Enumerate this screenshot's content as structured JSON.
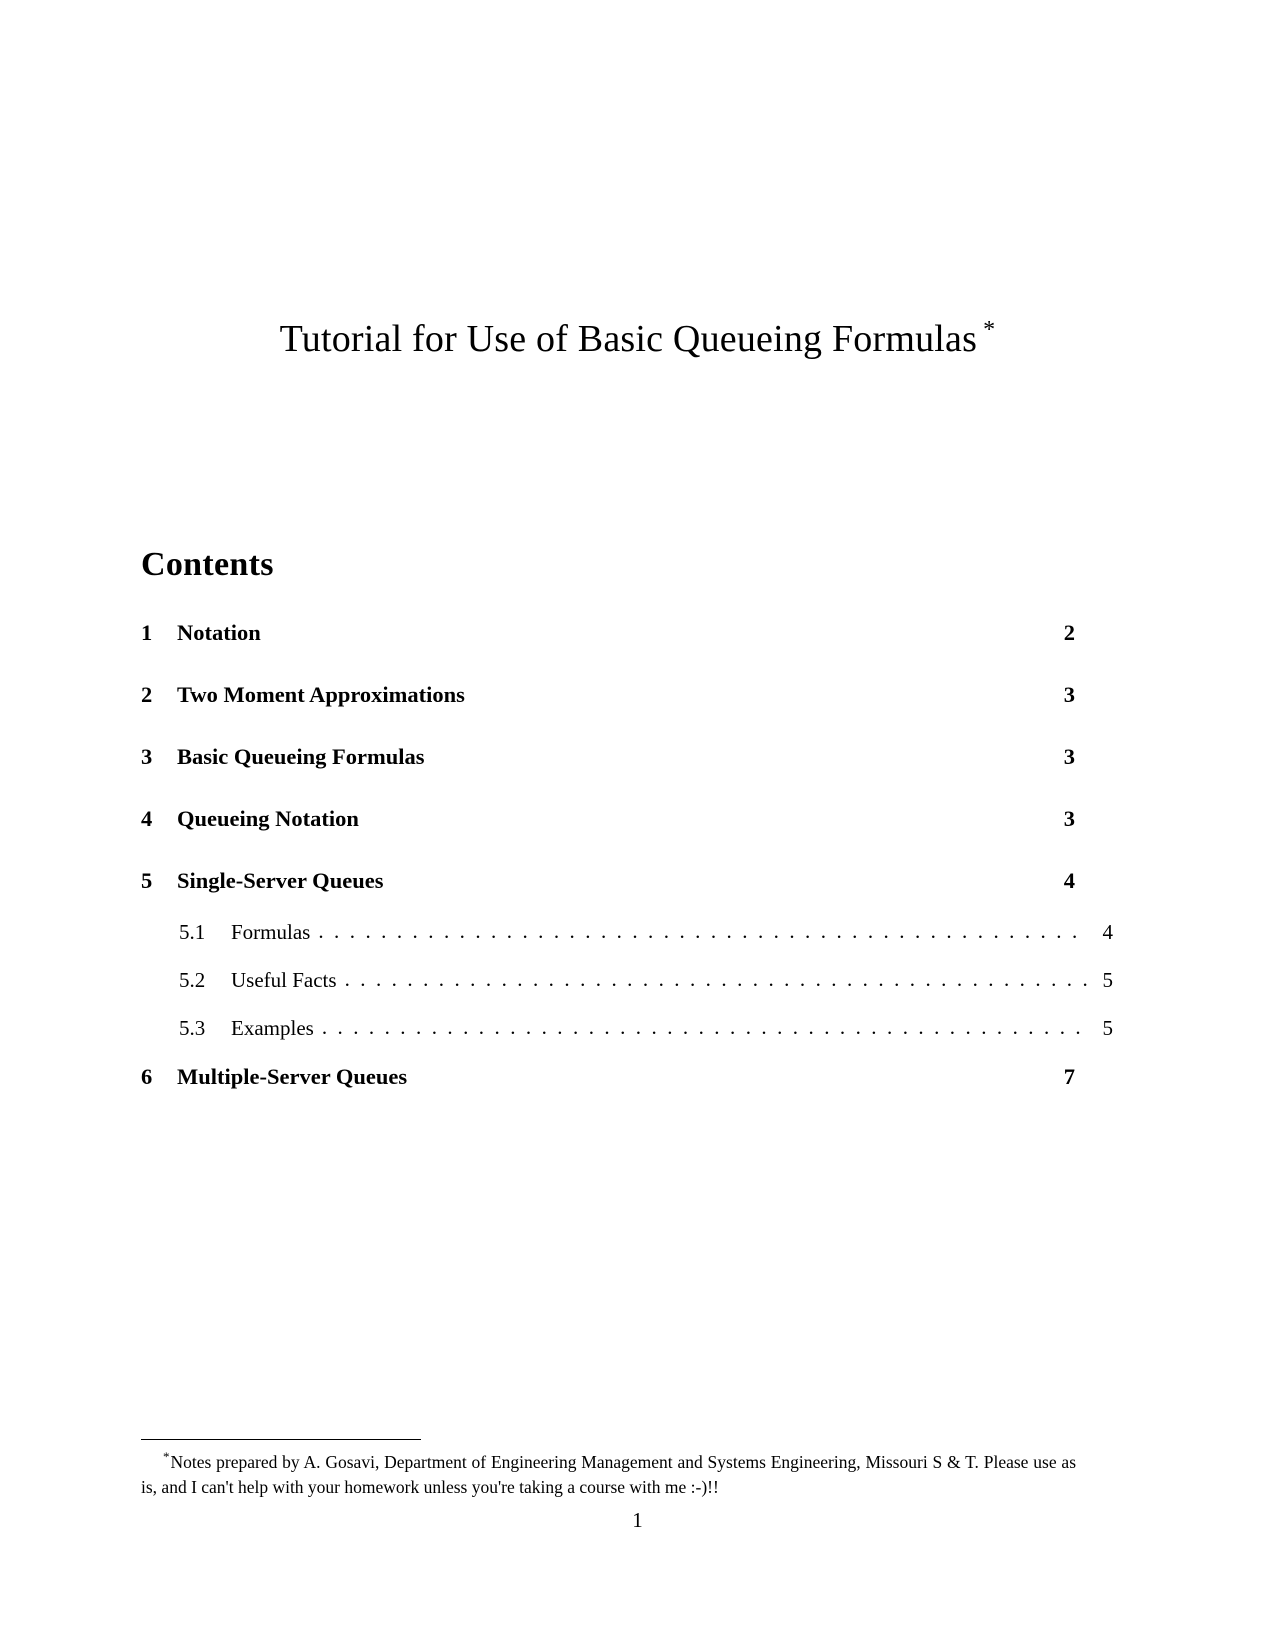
{
  "document": {
    "title": "Tutorial for Use of Basic Queueing Formulas",
    "title_footnote_mark": "*",
    "contents_heading": "Contents",
    "page_number": "1"
  },
  "toc": {
    "entries": [
      {
        "number": "1",
        "label": "Notation",
        "page": "2",
        "level": 1,
        "leader": false
      },
      {
        "number": "2",
        "label": "Two Moment Approximations",
        "page": "3",
        "level": 1,
        "leader": false
      },
      {
        "number": "3",
        "label": "Basic Queueing Formulas",
        "page": "3",
        "level": 1,
        "leader": false
      },
      {
        "number": "4",
        "label": "Queueing Notation",
        "page": "3",
        "level": 1,
        "leader": false
      },
      {
        "number": "5",
        "label": "Single-Server Queues",
        "page": "4",
        "level": 1,
        "leader": false
      },
      {
        "number": "5.1",
        "label": "Formulas",
        "page": "4",
        "level": 2,
        "leader": true
      },
      {
        "number": "5.2",
        "label": "Useful Facts",
        "page": "5",
        "level": 2,
        "leader": true
      },
      {
        "number": "5.3",
        "label": "Examples",
        "page": "5",
        "level": 2,
        "leader": true
      },
      {
        "number": "6",
        "label": "Multiple-Server Queues",
        "page": "7",
        "level": 1,
        "leader": false
      }
    ],
    "leader_dots": ". . . . . . . . . . . . . . . . . . . . . . . . . . . . . . . . . . . . . . . . . . . . . . . . . . . . . . . . . . . . . . . . . . . . . . . . . . . . . . . . . . . . . ."
  },
  "footnote": {
    "mark": "*",
    "text": "Notes prepared by A. Gosavi, Department of Engineering Management and Systems Engineering, Missouri S & T. Please use as is, and I can't help with your homework unless you're taking a course with me :-)!!"
  }
}
